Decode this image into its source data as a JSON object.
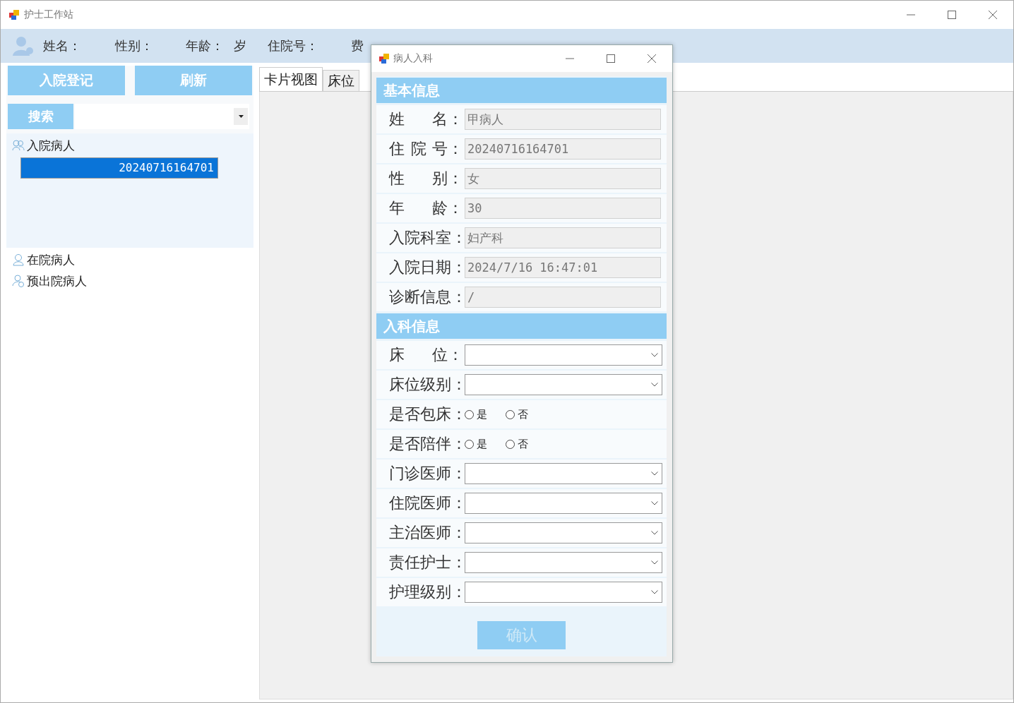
{
  "window": {
    "title": "护士工作站"
  },
  "header": {
    "fields": [
      "姓名：",
      "性别：",
      "年龄：",
      "岁",
      "住院号：",
      "费"
    ]
  },
  "actions": [
    {
      "label": "入院登记"
    },
    {
      "label": "刷新"
    }
  ],
  "search": {
    "button": "搜索"
  },
  "tree": [
    {
      "label": "入院病人",
      "expanded": true,
      "children": [
        {
          "label": "20240716164701",
          "selected": true
        }
      ]
    },
    {
      "label": "在院病人",
      "expanded": false
    },
    {
      "label": "预出院病人",
      "expanded": false
    }
  ],
  "tabs": [
    {
      "label": "卡片视图",
      "selected": true
    },
    {
      "label": "床位",
      "selected": false
    }
  ],
  "dialog": {
    "title": "病人入科",
    "sections": [
      {
        "title": "基本信息",
        "fields": [
          {
            "kind": "text",
            "label": "姓名：",
            "value": "甲病人"
          },
          {
            "kind": "text",
            "label": "住院号：",
            "value": "20240716164701"
          },
          {
            "kind": "text",
            "label": "性别：",
            "value": "女"
          },
          {
            "kind": "text",
            "label": "年龄：",
            "value": "30"
          },
          {
            "kind": "text",
            "label": "入院科室：",
            "value": "妇产科"
          },
          {
            "kind": "text",
            "label": "入院日期：",
            "value": "2024/7/16 16:47:01"
          },
          {
            "kind": "text",
            "label": "诊断信息：",
            "value": "/"
          }
        ]
      },
      {
        "title": "入科信息",
        "fields": [
          {
            "kind": "select",
            "label": "床位："
          },
          {
            "kind": "select",
            "label": "床位级别："
          },
          {
            "kind": "radio",
            "label": "是否包床：",
            "options": [
              {
                "label": "是",
                "selected": false
              },
              {
                "label": "否",
                "selected": false
              }
            ]
          },
          {
            "kind": "radio",
            "label": "是否陪伴：",
            "options": [
              {
                "label": "是",
                "selected": false
              },
              {
                "label": "否",
                "selected": false
              }
            ]
          },
          {
            "kind": "select",
            "label": "门诊医师："
          },
          {
            "kind": "select",
            "label": "住院医师："
          },
          {
            "kind": "select",
            "label": "主治医师："
          },
          {
            "kind": "select",
            "label": "责任护士："
          },
          {
            "kind": "select",
            "label": "护理级别："
          }
        ]
      }
    ],
    "confirm": {
      "label": "确认",
      "disabled": true
    }
  }
}
